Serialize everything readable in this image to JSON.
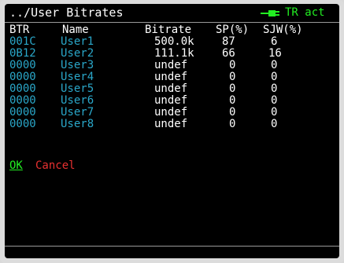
{
  "title": "../User Bitrates",
  "status": {
    "label": "TR act",
    "icon": "plug-icon",
    "color": "#22ee22"
  },
  "colors": {
    "id_text": "#2aa7c9",
    "value_text": "#ffffff",
    "ok": "#22ee22",
    "cancel": "#e83030"
  },
  "table": {
    "headers": {
      "btr": "BTR",
      "name": "Name",
      "bitrate": "Bitrate",
      "sp": "SP(%)",
      "sjw": "SJW(%)"
    },
    "rows": [
      {
        "btr": "001C",
        "name": "User1",
        "bitrate": "500.0k",
        "sp": "87",
        "sjw": "6"
      },
      {
        "btr": "0B12",
        "name": "User2",
        "bitrate": "111.1k",
        "sp": "66",
        "sjw": "16"
      },
      {
        "btr": "0000",
        "name": "User3",
        "bitrate": "undef",
        "sp": "0",
        "sjw": "0"
      },
      {
        "btr": "0000",
        "name": "User4",
        "bitrate": "undef",
        "sp": "0",
        "sjw": "0"
      },
      {
        "btr": "0000",
        "name": "User5",
        "bitrate": "undef",
        "sp": "0",
        "sjw": "0"
      },
      {
        "btr": "0000",
        "name": "User6",
        "bitrate": "undef",
        "sp": "0",
        "sjw": "0"
      },
      {
        "btr": "0000",
        "name": "User7",
        "bitrate": "undef",
        "sp": "0",
        "sjw": "0"
      },
      {
        "btr": "0000",
        "name": "User8",
        "bitrate": "undef",
        "sp": "0",
        "sjw": "0"
      }
    ]
  },
  "actions": {
    "ok": "OK",
    "cancel": "Cancel"
  }
}
